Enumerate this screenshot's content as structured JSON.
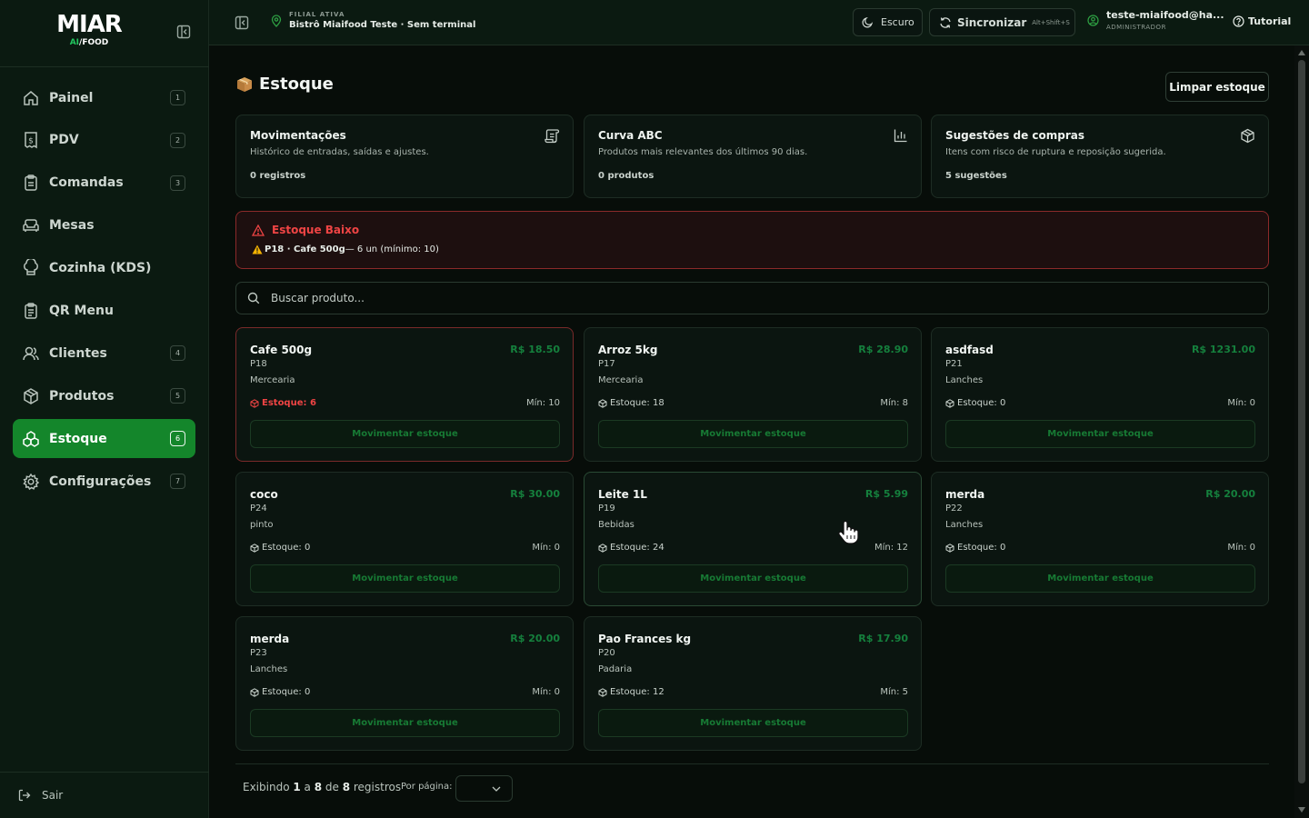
{
  "brand": {
    "logo_main": "MIAR",
    "logo_ai": "AI",
    "logo_sep": "/",
    "logo_food": "FOOD"
  },
  "nav": {
    "items": [
      {
        "label": "Painel",
        "shortcut": "1",
        "icon": "home-icon"
      },
      {
        "label": "PDV",
        "shortcut": "2",
        "icon": "receipt-dollar-icon"
      },
      {
        "label": "Comandas",
        "shortcut": "3",
        "icon": "clipboard-icon"
      },
      {
        "label": "Mesas",
        "shortcut": "",
        "icon": "sofa-icon"
      },
      {
        "label": "Cozinha (KDS)",
        "shortcut": "",
        "icon": "chef-hat-icon"
      },
      {
        "label": "QR Menu",
        "shortcut": "",
        "icon": "clipboard-list-icon"
      },
      {
        "label": "Clientes",
        "shortcut": "4",
        "icon": "users-icon"
      },
      {
        "label": "Produtos",
        "shortcut": "5",
        "icon": "package-icon"
      },
      {
        "label": "Estoque",
        "shortcut": "6",
        "icon": "boxes-icon",
        "active": true
      },
      {
        "label": "Configurações",
        "shortcut": "7",
        "icon": "gear-icon"
      }
    ],
    "logout": "Sair"
  },
  "topbar": {
    "filial_label": "FILIAL ATIVA",
    "filial_name": "Bistrô Miaifood Teste · Sem terminal",
    "theme": "Escuro",
    "sync": "Sincronizar",
    "sync_shortcut": "Alt+Shift+S",
    "user_email": "teste-miaifood@ha...",
    "user_role": "ADMINISTRADOR",
    "tutorial": "Tutorial"
  },
  "page": {
    "title": "Estoque",
    "clear_button": "Limpar estoque",
    "summary": [
      {
        "title": "Movimentações",
        "desc": "Histórico de entradas, saídas e ajustes.",
        "value": "0 registros",
        "icon": "scroll-icon"
      },
      {
        "title": "Curva ABC",
        "desc": "Produtos mais relevantes dos últimos 90 dias.",
        "value": "0 produtos",
        "icon": "bar-chart-icon"
      },
      {
        "title": "Sugestões de compras",
        "desc": "Itens com risco de ruptura e reposição sugerida.",
        "value": "5 sugestões",
        "icon": "package-icon"
      }
    ],
    "alert": {
      "title": "Estoque Baixo",
      "item_code": "P18 · Cafe 500g",
      "item_detail": " — 6 un (mínimo: 10)"
    },
    "search": {
      "placeholder": "Buscar produto..."
    },
    "move_label": "Movimentar estoque",
    "products": [
      {
        "name": "Cafe 500g",
        "price": "R$ 18.50",
        "code": "P18",
        "category": "Mercearia",
        "stock": "Estoque: 6",
        "min": "Mín: 10",
        "low": true
      },
      {
        "name": "Arroz 5kg",
        "price": "R$ 28.90",
        "code": "P17",
        "category": "Mercearia",
        "stock": "Estoque: 18",
        "min": "Mín: 8",
        "low": false
      },
      {
        "name": "asdfasd",
        "price": "R$ 1231.00",
        "code": "P21",
        "category": "Lanches",
        "stock": "Estoque: 0",
        "min": "Mín: 0",
        "low": false
      },
      {
        "name": "coco",
        "price": "R$ 30.00",
        "code": "P24",
        "category": "pinto",
        "stock": "Estoque: 0",
        "min": "Mín: 0",
        "low": false
      },
      {
        "name": "Leite 1L",
        "price": "R$ 5.99",
        "code": "P19",
        "category": "Bebidas",
        "stock": "Estoque: 24",
        "min": "Mín: 12",
        "low": false
      },
      {
        "name": "merda",
        "price": "R$ 20.00",
        "code": "P22",
        "category": "Lanches",
        "stock": "Estoque: 0",
        "min": "Mín: 0",
        "low": false
      },
      {
        "name": "merda",
        "price": "R$ 20.00",
        "code": "P23",
        "category": "Lanches",
        "stock": "Estoque: 0",
        "min": "Mín: 0",
        "low": false
      },
      {
        "name": "Pao Frances kg",
        "price": "R$ 17.90",
        "code": "P20",
        "category": "Padaria",
        "stock": "Estoque: 12",
        "min": "Mín: 5",
        "low": false
      }
    ],
    "pagination": {
      "prefix": "Exibindo ",
      "from": "1",
      "mid1": " a ",
      "to": "8",
      "mid2": " de ",
      "total": "8",
      "suffix": " registros",
      "per_page_label": "Por página:"
    }
  },
  "colors": {
    "accent": "#14862b",
    "danger": "#ef4444",
    "price": "#15803d"
  }
}
